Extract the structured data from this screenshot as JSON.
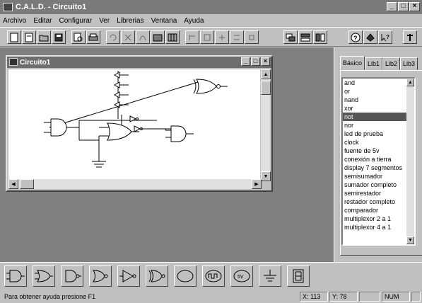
{
  "app": {
    "title": "C.A.L.D. - Circuito1"
  },
  "menu": [
    "Archivo",
    "Editar",
    "Configurar",
    "Ver",
    "Librerias",
    "Ventana",
    "Ayuda"
  ],
  "toolbar": {
    "icons": [
      "new-icon",
      "open-icon",
      "folder-icon",
      "save-icon",
      "print-preview-icon",
      "print-icon",
      "undo-icon",
      "cut-icon",
      "copy-icon",
      "paste-icon",
      "grid-icon",
      "align-icon",
      "align2-icon",
      "align3-icon",
      "align4-icon",
      "align5-icon",
      "cascade-icon",
      "tile-horizontal-icon",
      "tile-vertical-icon",
      "help-icon",
      "about-icon",
      "whats-this-icon",
      "pin-icon"
    ]
  },
  "child_window": {
    "title": "Circuito1"
  },
  "panel": {
    "tabs": [
      "Básico",
      "Lib1",
      "Lib2",
      "Lib3"
    ],
    "items": [
      "and",
      "or",
      "nand",
      "xor",
      "not",
      "nor",
      "led de prueba",
      "clock",
      "fuente de 5v",
      "conexión a tierra",
      "display 7 segmentos",
      "semisumador",
      "sumador completo",
      "semirestador",
      "restador completo",
      "comparador",
      "multiplexor 2 a 1",
      "multiplexor 4 a 1"
    ],
    "selected": "not"
  },
  "palette": [
    "and-gate",
    "or-gate",
    "nand-gate",
    "nor-gate",
    "buffer-gate",
    "xor-gate",
    "led",
    "clock",
    "power-5v",
    "ground",
    "display"
  ],
  "palette_labels": {
    "power": "5V"
  },
  "status": {
    "message": "Para obtener ayuda presione F1",
    "x": "X: 113",
    "y": "Y: 78",
    "num": "NUM"
  }
}
